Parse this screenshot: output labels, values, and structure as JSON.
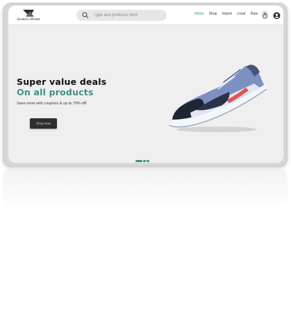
{
  "brand": {
    "name": "Sneakers Market",
    "accent_color": "#3e8f86",
    "logo_icon": "brand-logo-icon"
  },
  "search": {
    "placeholder": "Type and products here",
    "icon": "search-icon"
  },
  "nav": {
    "items": [
      "Home",
      "Shop",
      "Import",
      "Local",
      "Rare"
    ],
    "active": "Home"
  },
  "header_icons": {
    "bag": "shopping-bag-icon",
    "user": "user-icon"
  },
  "hero": {
    "title": "Super value deals",
    "subtitle": "On all products",
    "description": "Save more with coupons & up to 70% off!",
    "button_label": "Shop Now",
    "product_image": "sneaker-product-image"
  },
  "carousel": {
    "slides": 3,
    "active_slide": 1
  }
}
